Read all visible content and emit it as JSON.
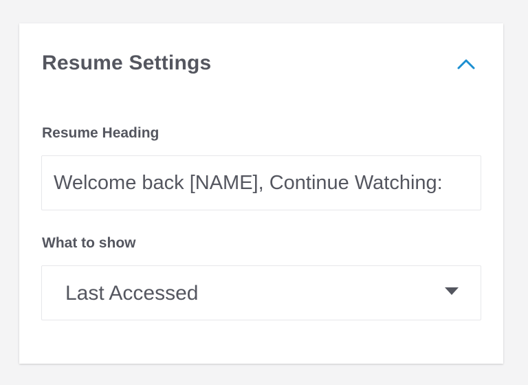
{
  "panel": {
    "title": "Resume Settings",
    "collapse_icon": "chevron-up-icon",
    "accent_color": "#1b8fd1"
  },
  "fields": {
    "heading_label": "Resume Heading",
    "heading_value": "Welcome back [NAME], Continue Watching:",
    "show_label": "What to show",
    "show_value": "Last Accessed"
  }
}
